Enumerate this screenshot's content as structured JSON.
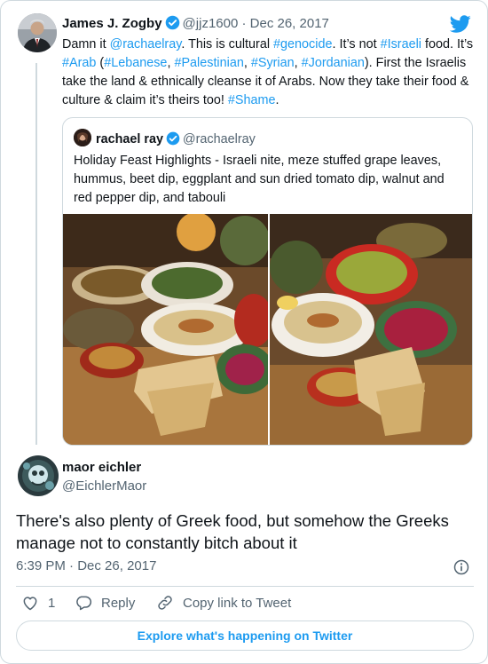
{
  "colors": {
    "accent": "#1d9bf0",
    "text": "#0f1419",
    "muted": "#536471",
    "border": "#cfd9de"
  },
  "icons": [
    "twitter-bird-icon",
    "verified-badge-icon",
    "info-icon",
    "heart-icon",
    "reply-icon",
    "link-icon"
  ],
  "tweet": {
    "author_name": "James J. Zogby",
    "author_handle": "@jjz1600",
    "date": "Dec 26, 2017",
    "text": {
      "t1": "Damn it ",
      "m1": "@rachaelray",
      "t2": ". This is cultural ",
      "h1": "#genocide",
      "t3": ". It’s not ",
      "h2": "#Israeli",
      "t4": " food. It’s ",
      "h3": "#Arab",
      "t5": " (",
      "h4": "#Lebanese",
      "t6": ", ",
      "h5": "#Palestinian",
      "t7": ", ",
      "h6": "#Syrian",
      "t8": ", ",
      "h7": "#Jordanian",
      "t9": "). First the Israelis take the land & ethnically cleanse it of Arabs. Now they take their food & culture & claim it’s theirs too! ",
      "h8": "#Shame",
      "t10": "."
    }
  },
  "quote": {
    "author_name": "rachael ray",
    "author_handle": "@rachaelray",
    "text": "Holiday Feast Highlights - Israeli nite, meze stuffed grape leaves, hummus, beet dip, eggplant and sun dried tomato dip, walnut and red pepper dip, and tabouli"
  },
  "reply": {
    "author_name": "maor eichler",
    "author_handle": "@EichlerMaor",
    "text": "There's also plenty of Greek food, but somehow the Greeks manage not to constantly bitch about it",
    "time": "6:39 PM",
    "separator": "·",
    "date": "Dec 26, 2017"
  },
  "actions": {
    "likes": "1",
    "reply_label": "Reply",
    "copy_link_label": "Copy link to Tweet"
  },
  "footer": {
    "explore_label": "Explore what's happening on Twitter"
  }
}
